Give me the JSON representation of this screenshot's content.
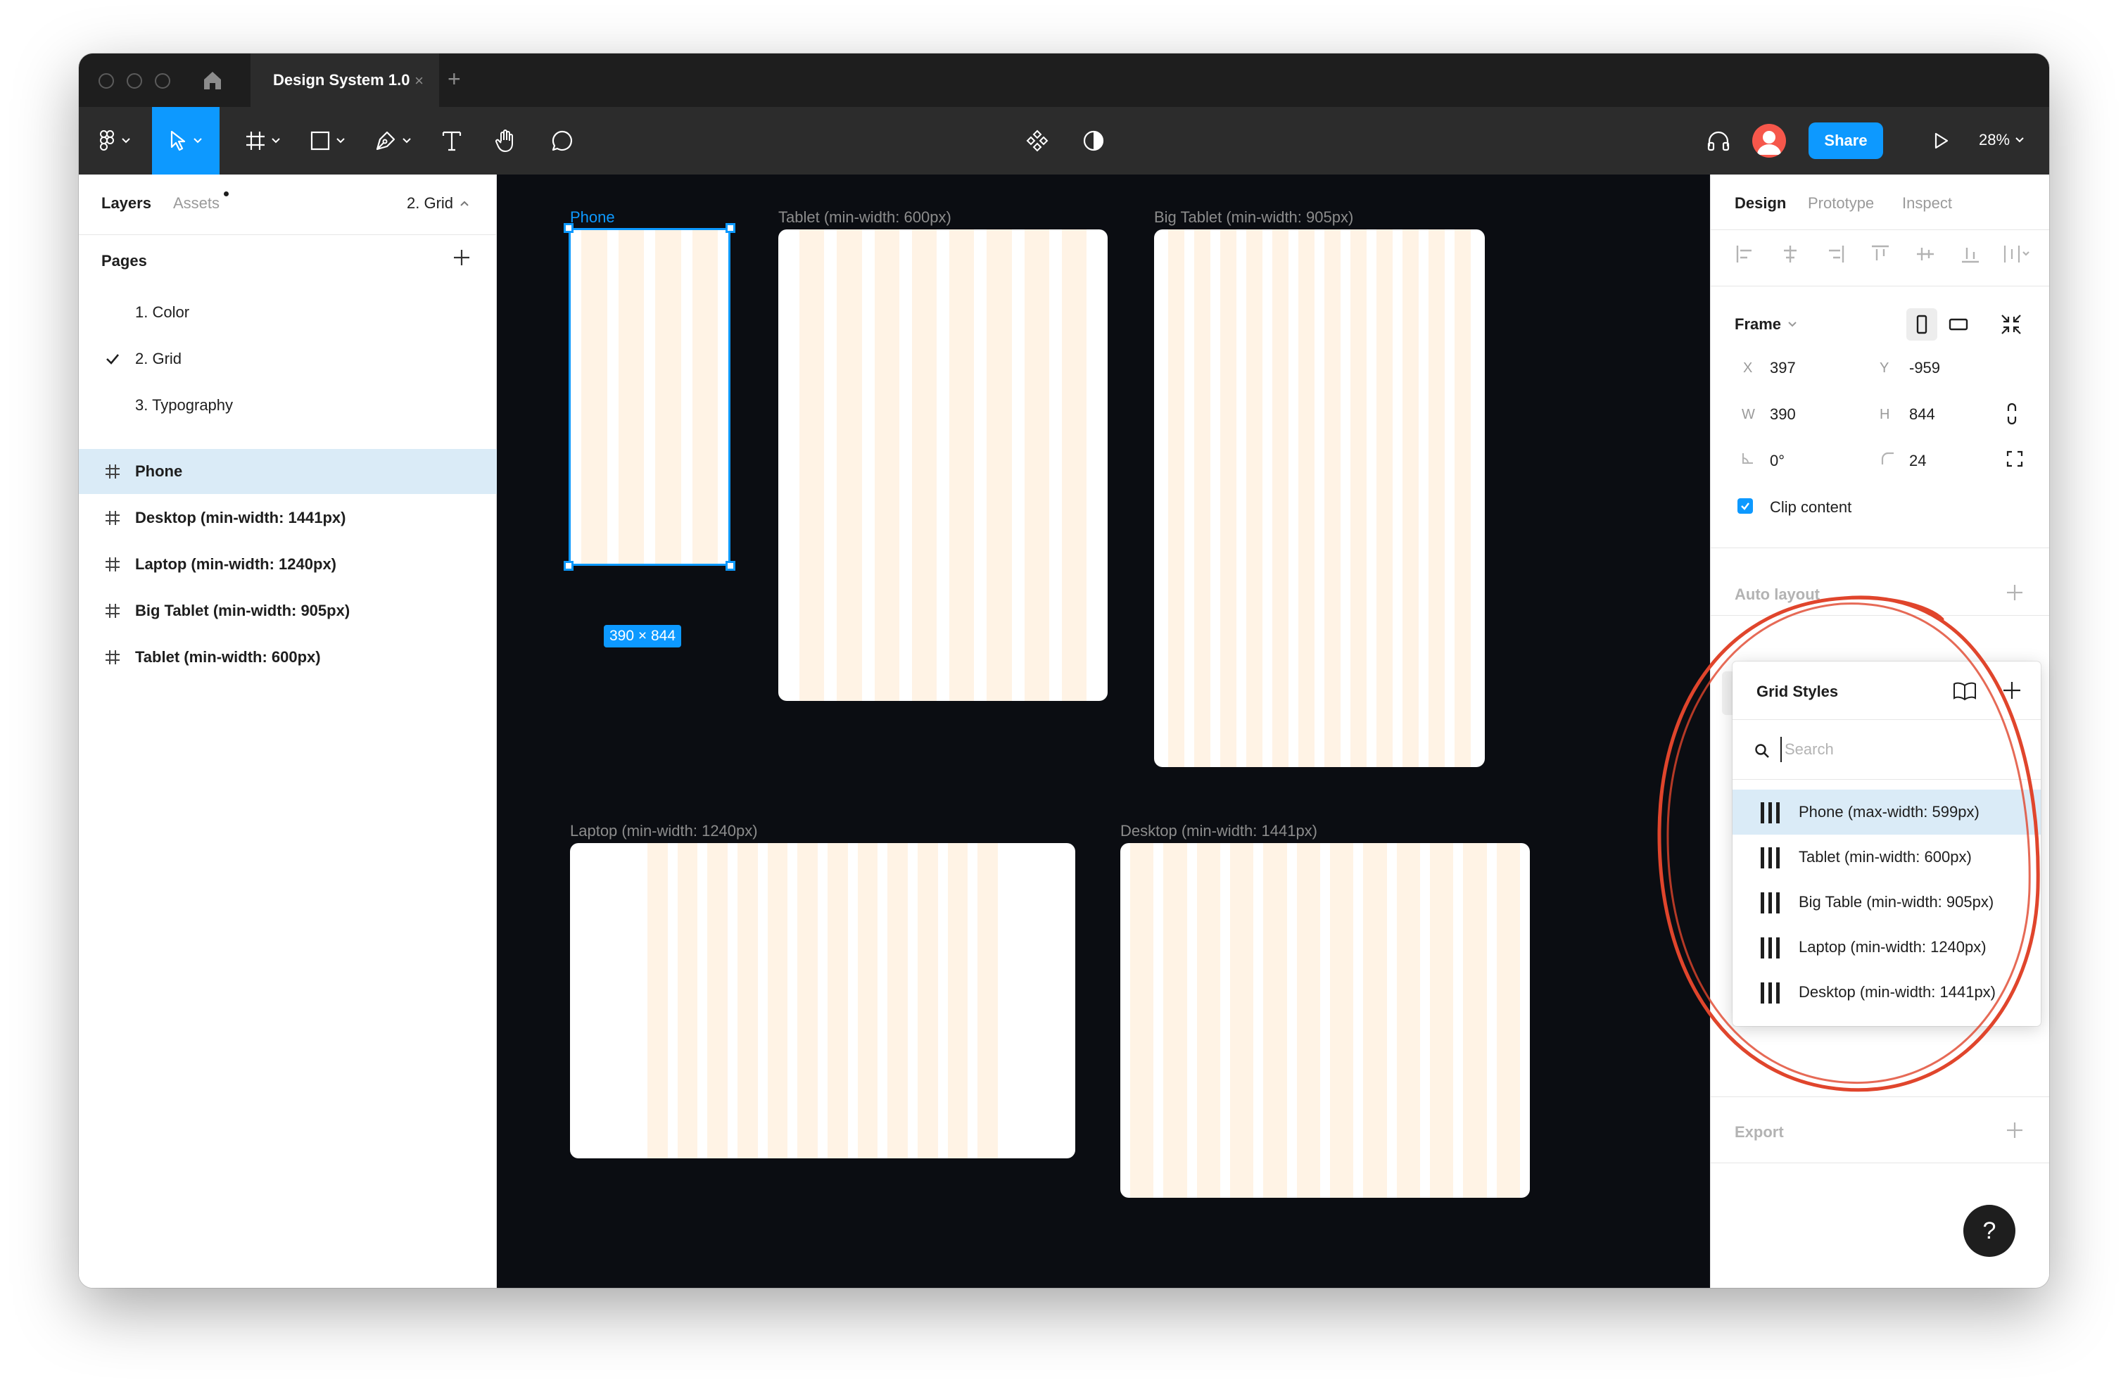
{
  "colors": {
    "accent": "#0d99ff",
    "grid_column": "#fff3e5",
    "canvas_bg": "#0b0d12",
    "annotation": "#e0452c"
  },
  "titlebar": {
    "home_icon": "home-icon",
    "tab_title": "Design System 1.0",
    "tab_close": "×",
    "new_tab": "+"
  },
  "toolbar": {
    "tools": [
      "main-menu",
      "move",
      "frame",
      "shape",
      "pen",
      "text",
      "hand",
      "comment"
    ],
    "share_label": "Share",
    "zoom": "28%"
  },
  "left_panel": {
    "tabs": {
      "layers": "Layers",
      "assets": "Assets"
    },
    "current_page": "2. Grid",
    "pages_header": "Pages",
    "pages": [
      {
        "label": "1. Color",
        "selected": false
      },
      {
        "label": "2. Grid",
        "selected": true
      },
      {
        "label": "3. Typography",
        "selected": false
      }
    ],
    "layers": [
      {
        "label": "Phone",
        "selected": true
      },
      {
        "label": "Desktop (min-width: 1441px)",
        "selected": false
      },
      {
        "label": "Laptop (min-width: 1240px)",
        "selected": false
      },
      {
        "label": "Big Tablet (min-width: 905px)",
        "selected": false
      },
      {
        "label": "Tablet (min-width: 600px)",
        "selected": false
      }
    ]
  },
  "canvas": {
    "frames": [
      {
        "label": "Phone",
        "selected": true
      },
      {
        "label": "Tablet (min-width: 600px)",
        "selected": false
      },
      {
        "label": "Big Tablet (min-width: 905px)",
        "selected": false
      },
      {
        "label": "Laptop (min-width: 1240px)",
        "selected": false
      },
      {
        "label": "Desktop (min-width: 1441px)",
        "selected": false
      }
    ],
    "selection_size": "390 × 844"
  },
  "right_panel": {
    "tabs": {
      "design": "Design",
      "prototype": "Prototype",
      "inspect": "Inspect"
    },
    "frame_header": "Frame",
    "x_label": "X",
    "x_value": "397",
    "y_label": "Y",
    "y_value": "-959",
    "w_label": "W",
    "w_value": "390",
    "h_label": "H",
    "h_value": "844",
    "rotation_value": "0°",
    "radius_value": "24",
    "clip_content_label": "Clip content",
    "auto_layout_header": "Auto layout",
    "layout_grid_style": "Phone (max-width: 599px)",
    "export_header": "Export"
  },
  "grid_styles_dropdown": {
    "title": "Grid Styles",
    "search_placeholder": "Search",
    "items": [
      {
        "label": "Phone (max-width: 599px)",
        "selected": true
      },
      {
        "label": "Tablet (min-width: 600px)",
        "selected": false
      },
      {
        "label": "Big Table (min-width: 905px)",
        "selected": false
      },
      {
        "label": "Laptop (min-width: 1240px)",
        "selected": false
      },
      {
        "label": "Desktop (min-width: 1441px)",
        "selected": false
      }
    ]
  },
  "help": {
    "label": "?"
  }
}
